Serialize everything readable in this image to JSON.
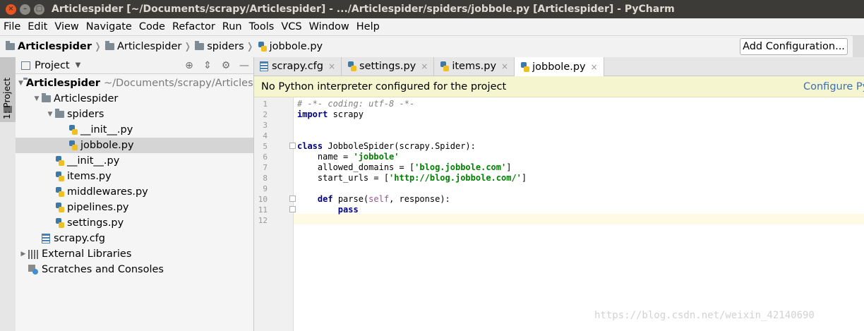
{
  "window": {
    "title": "Articlespider [~/Documents/scrapy/Articlespider] - .../Articlespider/spiders/jobbole.py [Articlespider] - PyCharm"
  },
  "menu": [
    "File",
    "Edit",
    "View",
    "Navigate",
    "Code",
    "Refactor",
    "Run",
    "Tools",
    "VCS",
    "Window",
    "Help"
  ],
  "breadcrumb": [
    "Articlespider",
    "Articlespider",
    "spiders",
    "jobbole.py"
  ],
  "toolbar": {
    "add_configuration": "Add Configuration..."
  },
  "tool_strip": {
    "project_tab": "1: Project"
  },
  "project_panel": {
    "title": "Project",
    "tree": [
      {
        "label": "Articlespider",
        "path": "~/Documents/scrapy/Articlespider",
        "depth": 0,
        "expanded": true,
        "icon": "folder-icon",
        "bold": true
      },
      {
        "label": "Articlespider",
        "depth": 1,
        "expanded": true,
        "icon": "folder-icon"
      },
      {
        "label": "spiders",
        "depth": 2,
        "expanded": true,
        "icon": "folder-icon"
      },
      {
        "label": "__init__.py",
        "depth": 3,
        "icon": "python-file-icon"
      },
      {
        "label": "jobbole.py",
        "depth": 3,
        "icon": "python-file-icon",
        "selected": true
      },
      {
        "label": "__init__.py",
        "depth": 2,
        "icon": "python-file-icon"
      },
      {
        "label": "items.py",
        "depth": 2,
        "icon": "python-file-icon"
      },
      {
        "label": "middlewares.py",
        "depth": 2,
        "icon": "python-file-icon"
      },
      {
        "label": "pipelines.py",
        "depth": 2,
        "icon": "python-file-icon"
      },
      {
        "label": "settings.py",
        "depth": 2,
        "icon": "python-file-icon"
      },
      {
        "label": "scrapy.cfg",
        "depth": 1,
        "icon": "config-file-icon"
      },
      {
        "label": "External Libraries",
        "depth": 0,
        "collapsed": true,
        "icon": "library-icon"
      },
      {
        "label": "Scratches and Consoles",
        "depth": 0,
        "icon": "scratches-icon"
      }
    ]
  },
  "editor_tabs": [
    {
      "label": "scrapy.cfg",
      "icon": "config-file-icon"
    },
    {
      "label": "settings.py",
      "icon": "python-file-icon"
    },
    {
      "label": "items.py",
      "icon": "python-file-icon"
    },
    {
      "label": "jobbole.py",
      "icon": "python-file-icon",
      "active": true
    }
  ],
  "banner": {
    "message": "No Python interpreter configured for the project",
    "link": "Configure Py"
  },
  "code": {
    "line_numbers": [
      "1",
      "2",
      "3",
      "4",
      "5",
      "6",
      "7",
      "8",
      "9",
      "10",
      "11",
      "12"
    ],
    "current_line": 12
  },
  "watermark": "https://blog.csdn.net/weixin_42140690"
}
